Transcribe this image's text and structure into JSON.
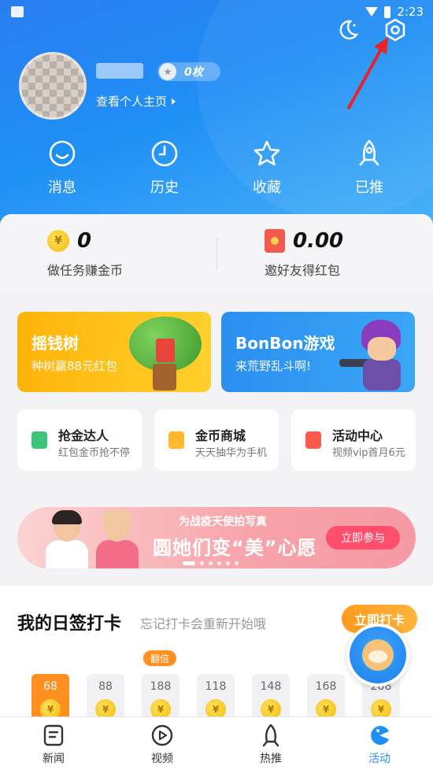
{
  "status_bar": {
    "time": "2:23"
  },
  "header": {
    "badge_count": "0枚",
    "profile_link": "查看个人主页"
  },
  "quick_actions": [
    {
      "label": "消息",
      "icon": "message-icon"
    },
    {
      "label": "历史",
      "icon": "clock-icon"
    },
    {
      "label": "收藏",
      "icon": "star-icon"
    },
    {
      "label": "已推",
      "icon": "rocket-icon"
    }
  ],
  "wallet": {
    "coins": {
      "value": "0",
      "label": "做任务赚金币"
    },
    "red_packet": {
      "value": "0.00",
      "label": "邀好友得红包"
    }
  },
  "promos": [
    {
      "title": "摇钱树",
      "subtitle": "种树赢88元红包"
    },
    {
      "title": "BonBon游戏",
      "subtitle": "来荒野乱斗啊!"
    }
  ],
  "mini_cards": [
    {
      "title": "抢金达人",
      "subtitle": "红包金币抢不停",
      "color": "#3bc47a"
    },
    {
      "title": "金币商城",
      "subtitle": "天天抽华为手机",
      "color": "#ffb82b"
    },
    {
      "title": "活动中心",
      "subtitle": "视频vip首月6元",
      "color": "#ff5a4e"
    }
  ],
  "banner": {
    "small_text": "为战疫天使拍写真",
    "big_text": "圆她们变“美”心愿",
    "button": "立即参与"
  },
  "checkin": {
    "title": "我的日签打卡",
    "subtitle": "忘记打卡会重新开始哦",
    "button": "立即打卡",
    "double_tag": "翻倍",
    "days": [
      "68",
      "88",
      "188",
      "118",
      "148",
      "168",
      "288"
    ]
  },
  "tabs": [
    {
      "label": "新闻",
      "icon": "news-icon"
    },
    {
      "label": "视频",
      "icon": "play-icon"
    },
    {
      "label": "热推",
      "icon": "rocket-icon"
    },
    {
      "label": "活动",
      "icon": "activity-icon"
    }
  ],
  "colors": {
    "primary": "#1f8ff5",
    "accent_orange": "#ff8f1f",
    "banner_pink": "#f7a3a8"
  }
}
